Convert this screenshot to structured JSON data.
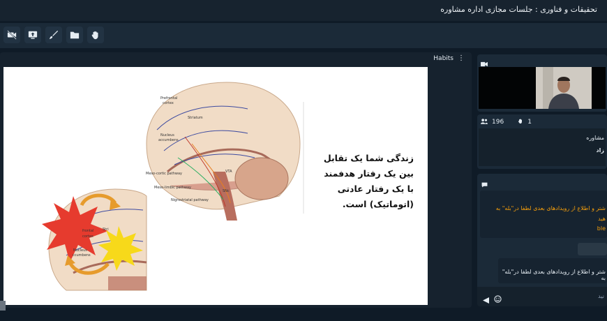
{
  "window": {
    "title": "تحقیقات و فناوری : جلسات مجازی اداره مشاوره"
  },
  "toolbar": {
    "buttons": [
      "camera-off-icon",
      "share-screen-icon",
      "brush-icon",
      "folder-icon",
      "hand-icon"
    ]
  },
  "stage": {
    "title": "Habits"
  },
  "slide": {
    "lines": [
      "زندگی شما یک تقابل",
      "بین یک رفتار هدفمند",
      "با یک رفتار عادتی",
      "(اتوماتیک) است."
    ],
    "labels": {
      "prefrontal": "Prefrontal",
      "cortex": "cortex",
      "striatum": "Striatum",
      "nucleus": "Nucleus",
      "accumbens": "accumbens",
      "mesocortic": "Meso-cortic pathway",
      "mesolimbic": "Meso-limbic pathway",
      "nigrostriatal": "Nigrostriatal pathway",
      "vta": "VTA",
      "snc": "SNc",
      "s_partial": "Stri",
      "frontal_partial": "frontal",
      "cortex_partial": "cortex",
      "nucleus2": "Nucleus",
      "accumbens_partial": "ccumbens"
    }
  },
  "participants": {
    "count": "196",
    "hands": "1"
  },
  "info": {
    "line1": "مشاوره",
    "line2": "زاد"
  },
  "chat": {
    "msg1": [
      "شتر و اطلاع از رویدادهای بعدی لطفا در\"بله\" به",
      "هید",
      "ble"
    ],
    "msg2": "شتر و اطلاع از رویدادهای بعدی لطفا در\"بله\" به",
    "placeholder": "نید"
  },
  "colors": {
    "accent_orange": "#f59e0b",
    "bg": "#0f1b27",
    "panel": "#1b2a38"
  }
}
